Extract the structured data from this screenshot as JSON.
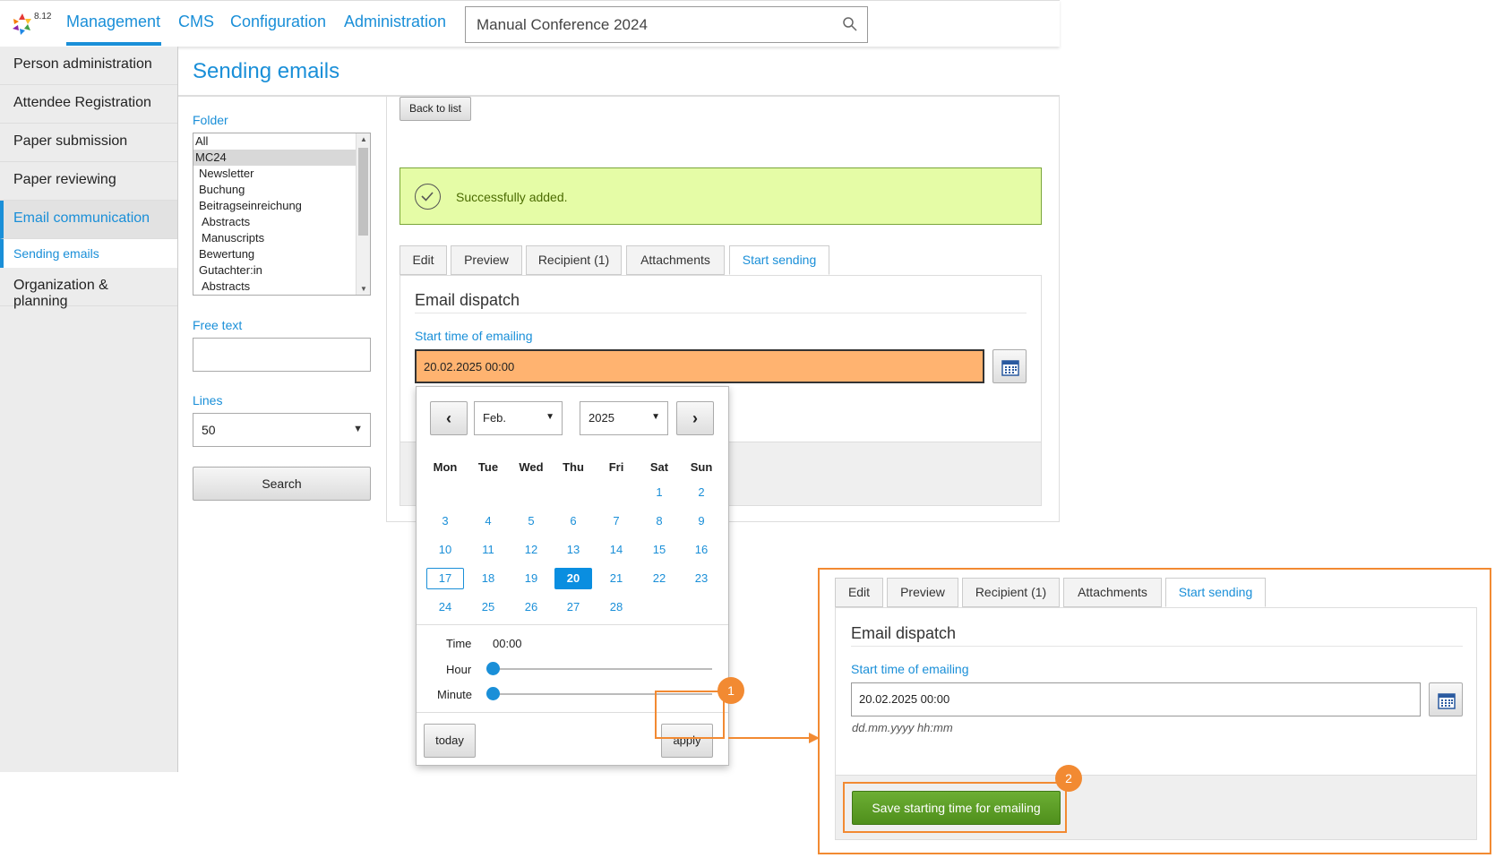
{
  "app": {
    "version": "8.12"
  },
  "nav": {
    "items": [
      "Management",
      "CMS",
      "Configuration",
      "Administration"
    ]
  },
  "search": {
    "value": "Manual Conference 2024"
  },
  "sidebar": {
    "items": [
      "Person administration",
      "Attendee Registration",
      "Paper submission",
      "Paper reviewing",
      "Email communication",
      "Organization & planning"
    ],
    "active_sub": "Sending emails"
  },
  "page": {
    "title": "Sending emails"
  },
  "filters": {
    "folder_label": "Folder",
    "folders": [
      "All",
      "MC24",
      "Newsletter",
      "Buchung",
      "Beitragseinreichung",
      "Abstracts",
      "Manuscripts",
      "Bewertung",
      "Gutachter:in",
      "Abstracts"
    ],
    "selected_folder": "MC24",
    "freetext_label": "Free text",
    "lines_label": "Lines",
    "lines_value": "50",
    "search_button": "Search"
  },
  "main": {
    "back_button": "Back to list",
    "success_message": "Successfully added.",
    "tabs": [
      "Edit",
      "Preview",
      "Recipient (1)",
      "Attachments",
      "Start sending"
    ],
    "active_tab": "Start sending",
    "section_title": "Email dispatch",
    "start_time_label": "Start time of emailing",
    "start_time_value": "20.02.2025 00:00",
    "date_hint": "dd.mm.yyyy hh:mm",
    "save_button": "Save starting time for emailing"
  },
  "datepicker": {
    "month": "Feb.",
    "year": "2025",
    "weekdays": [
      "Mon",
      "Tue",
      "Wed",
      "Thu",
      "Fri",
      "Sat",
      "Sun"
    ],
    "first_weekday_index": 5,
    "days_in_month": 28,
    "today": 17,
    "selected": 20,
    "time_label": "Time",
    "time_value": "00:00",
    "hour_label": "Hour",
    "minute_label": "Minute",
    "hour": 0,
    "minute": 0,
    "today_button": "today",
    "apply_button": "apply"
  },
  "callouts": {
    "step1": "1",
    "step2": "2"
  },
  "colors": {
    "accent": "#1a8fd8",
    "callout": "#f28a32",
    "success_bg": "#e5fca6",
    "save_green": "#5a9e25",
    "highlight_input": "#ffb370"
  }
}
